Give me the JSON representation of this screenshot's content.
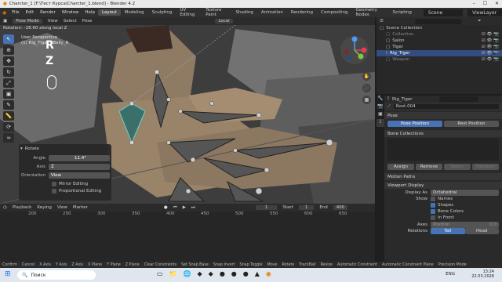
{
  "window": {
    "title": "Charcter_1 [F:\\Тест Курса\\Charcter_1.blend] - Blender 4.2"
  },
  "menu": [
    "File",
    "Edit",
    "Render",
    "Window",
    "Help"
  ],
  "workspaces": [
    "Layout",
    "Modeling",
    "Sculpting",
    "UV Editing",
    "Texture Paint",
    "Shading",
    "Animation",
    "Rendering",
    "Compositing",
    "Geometry Nodes",
    "Scripting"
  ],
  "active_workspace": "Layout",
  "scene": {
    "scene_label": "Scene",
    "view_layer_label": "ViewLayer"
  },
  "viewport_header": {
    "mode": "Pose Mode",
    "items": [
      "View",
      "Select",
      "Pose"
    ],
    "orientation": "Local"
  },
  "status_message": "Rotation: -28.60 along local Z",
  "viewport_info": {
    "perspective": "User Perspective",
    "object": "(1) Rig_Tiger : Belly_R"
  },
  "key_hints": [
    "R",
    "Z"
  ],
  "rotate_panel": {
    "title": "Rotate",
    "angle_label": "Angle",
    "angle_value": "11.4°",
    "axis_label": "Axis",
    "axis_value": "Z",
    "orientation_label": "Orientation",
    "orientation_value": "View",
    "mirror": "Mirror Editing",
    "proportional": "Proportional Editing"
  },
  "timeline_header": {
    "items": [
      "Playback",
      "Keying",
      "View",
      "Marker"
    ],
    "current_frame": "1",
    "start_label": "Start",
    "start": "1",
    "end_label": "End",
    "end": "400"
  },
  "timeline_ticks": [
    "200",
    "250",
    "300",
    "350",
    "400",
    "450",
    "500",
    "550",
    "600",
    "650"
  ],
  "outliner": {
    "title": "Scene Collection",
    "rows": [
      {
        "label": "Collection",
        "selected": false,
        "dim": true
      },
      {
        "label": "Salon",
        "selected": false,
        "dim": false
      },
      {
        "label": "Tiger",
        "selected": false,
        "dim": false
      },
      {
        "label": "Rig_Tiger",
        "selected": true,
        "dim": false
      },
      {
        "label": "Weapon",
        "selected": false,
        "dim": true
      }
    ]
  },
  "properties": {
    "object_name": "Rig_Tiger",
    "bone_name": "Root.004",
    "bone_field": "Root.004",
    "pose_section": "Pose",
    "pose_position": "Pose Position",
    "rest_position": "Rest Position",
    "bone_collections": "Bone Collections",
    "buttons": [
      "Assign",
      "Remove",
      "Select",
      "Deselect"
    ],
    "motion_paths": "Motion Paths",
    "viewport_display": "Viewport Display",
    "display_as_label": "Display As",
    "display_as_value": "Octahedral",
    "show_label": "Show",
    "show_items": [
      {
        "label": "Names",
        "checked": false
      },
      {
        "label": "Shapes",
        "checked": true
      },
      {
        "label": "Bone Colors",
        "checked": true
      },
      {
        "label": "In Front",
        "checked": false
      }
    ],
    "axes_label": "Axes",
    "axes_position": "Position",
    "axes_value": "0.0",
    "relations_label": "Relations",
    "relations_value": "Tail",
    "relations_head": "Head"
  },
  "statusbar": [
    "Confirm",
    "Cancel",
    "X Axis",
    "Y Axis",
    "Z Axis",
    "X Plane",
    "Y Plane",
    "Z Plane",
    "Clear Constraints",
    "Set Snap Base",
    "Snap Invert",
    "Snap Toggle",
    "Move",
    "Rotate",
    "TrackBall",
    "Resize",
    "Automatic Constraint",
    "Automatic Constraint Plane",
    "Precision Mode"
  ],
  "taskbar": {
    "search": "Поиск",
    "lang": "ENG",
    "time": "13:24",
    "date": "22.03.2026"
  },
  "colors": {
    "accent": "#4772b3",
    "bone_selected": "#3b6f6a",
    "bone_active": "#6fd0c8"
  }
}
